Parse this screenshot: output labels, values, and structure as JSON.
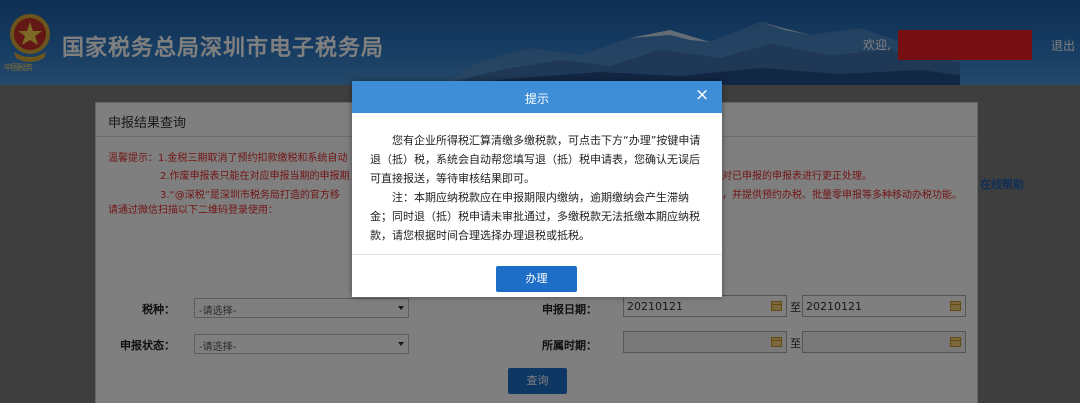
{
  "header": {
    "site_title": "国家税务总局深圳市电子税务局",
    "emblem_label": "中国税务",
    "welcome": "欢迎,",
    "logout": "退出",
    "colors": {
      "header_blue": "#2f7bc6",
      "redaction": "#ec1c24"
    }
  },
  "panel": {
    "title": "申报结果查询",
    "tips": {
      "line1": "温馨提示：1.金税三期取消了预约扣款缴税和系统自动",
      "line2": "2.作废申报表只能在对应申报当期的申报期",
      "line2_tail": "对已申报的申报表进行更正处理。",
      "line3": "3.“@深税”是深圳市税务局打造的官方移",
      "line3_tail": "，并提供预约办税、批量零申报等多种移动办税功能。",
      "line4": "请通过微信扫描以下二维码登录使用："
    },
    "help_link": "在线帮助"
  },
  "form": {
    "tax_type_label": "税种：",
    "tax_type_value": "-请选择-",
    "status_label": "申报状态：",
    "status_value": "-请选择-",
    "declare_date_label": "申报日期：",
    "declare_date_from": "20210121",
    "declare_date_to": "20210121",
    "to": "至",
    "period_label": "所属时期：",
    "period_from": "",
    "period_to": "",
    "query_button": "查询"
  },
  "modal": {
    "title": "提示",
    "close": "×",
    "paragraph1": "您有企业所得税汇算清缴多缴税款，可点击下方“办理”按键申请退（抵）税，系统会自动帮您填写退（抵）税申请表，您确认无误后可直接报送，等待审核结果即可。",
    "paragraph2": "注：本期应纳税款应在申报期限内缴纳，逾期缴纳会产生滞纳金；同时退（抵）税申请未审批通过，多缴税款无法抵缴本期应纳税款，请您根据时间合理选择办理退税或抵税。",
    "button": "办理",
    "colors": {
      "head": "#3d8ed6",
      "button": "#1d6ec6"
    }
  }
}
